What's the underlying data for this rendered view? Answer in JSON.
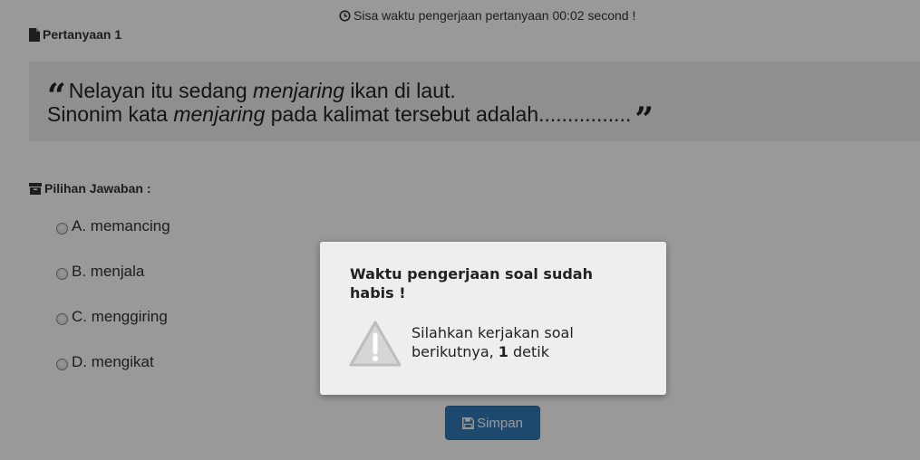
{
  "timer": {
    "icon": "clock-icon",
    "text": "Sisa waktu pengerjaan pertanyaan 00:02 second !"
  },
  "question": {
    "icon": "file-icon",
    "title": "Pertanyaan 1",
    "line1_a": "Nelayan itu sedang ",
    "line1_em": "menjaring",
    "line1_b": " ikan di laut.",
    "line2_a": "Sinonim kata ",
    "line2_em": "menjaring",
    "line2_b": " pada kalimat tersebut adalah................",
    "open_quote": "“",
    "close_quote": "”"
  },
  "answers": {
    "icon": "archive-icon",
    "title": "Pilihan Jawaban :",
    "options": [
      {
        "label": "A. memancing"
      },
      {
        "label": "B. menjala"
      },
      {
        "label": "C. menggiring"
      },
      {
        "label": "D. mengikat"
      }
    ]
  },
  "save_button": {
    "icon": "floppy-disk-icon",
    "label": "Simpan",
    "color": "#337ab7"
  },
  "dialog": {
    "icon": "warning-icon",
    "title": "Waktu pengerjaan soal sudah habis !",
    "msg_a": "Silahkan kerjakan soal berikutnya, ",
    "seconds": "1",
    "msg_b": " detik"
  }
}
